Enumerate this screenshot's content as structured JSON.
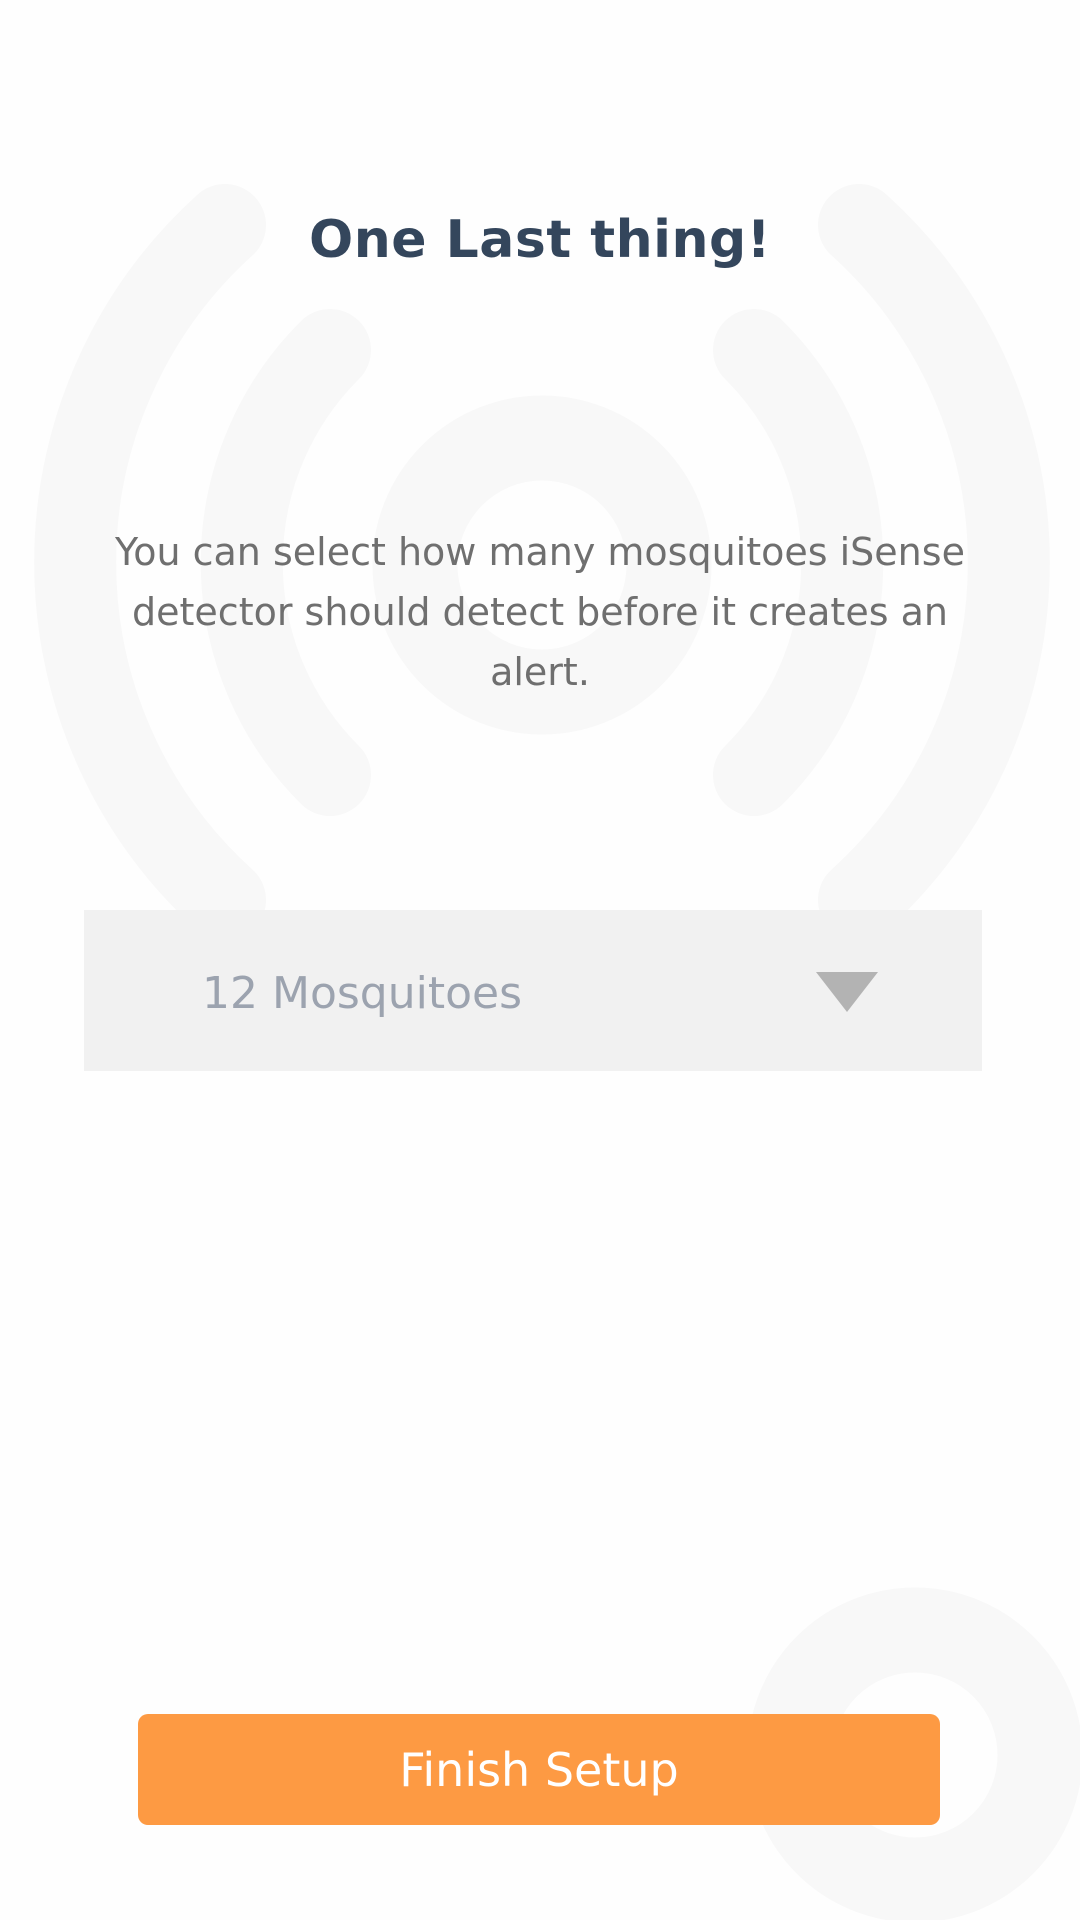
{
  "title": "One Last thing!",
  "description": "You can select how many mosquitoes iSense detector should detect before it creates an alert.",
  "threshold_select": {
    "value": "12 Mosquitoes",
    "arrow_icon": "triangle-down-icon"
  },
  "finish_button": {
    "label": "Finish Setup"
  },
  "colors": {
    "accent": "#fd9a43",
    "title": "#34465c",
    "body_text": "#6f6f6f",
    "select_background": "#f1f1f1",
    "background_art": "#f8f8f8"
  }
}
